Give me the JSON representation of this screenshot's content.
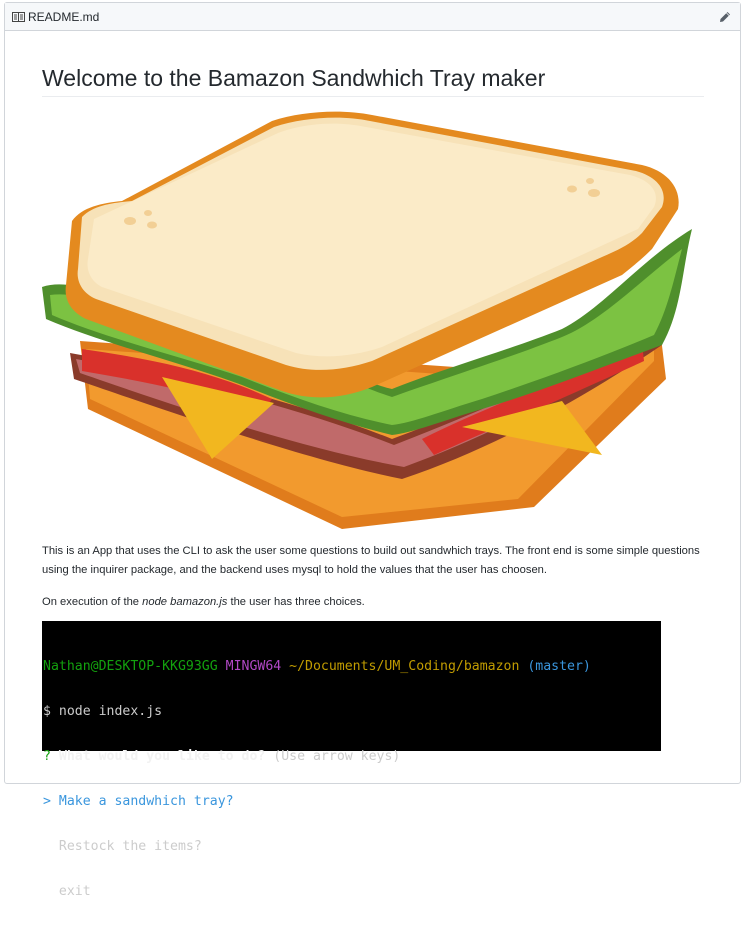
{
  "header": {
    "file_name": "README.md",
    "file_icon": "book-icon",
    "edit_icon": "pencil-icon"
  },
  "readme": {
    "title": "Welcome to the Bamazon Sandwhich Tray maker",
    "image": "sandwich-illustration",
    "paragraph1": "This is an App that uses the CLI to ask the user some questions to build out sandwhich trays. The front end is some simple questions using the inquirer package, and the backend uses mysql to hold the values that the user has choosen.",
    "paragraph2_prefix": "On execution of the ",
    "paragraph2_code": "node bamazon.js",
    "paragraph2_suffix": " the user has three choices."
  },
  "terminal": {
    "prompt_user": "Nathan@DESKTOP-KKG93GG",
    "prompt_env": "MINGW64",
    "prompt_path": "~/Documents/UM_Coding/bamazon",
    "prompt_branch": "(master)",
    "command_symbol": "$",
    "command": "node index.js",
    "question_symbol": "?",
    "question": "What would you like to do?",
    "hint": "(Use arrow keys)",
    "selected_symbol": ">",
    "options": [
      "Make a sandwhich tray?",
      "Restock the items?",
      "exit"
    ],
    "colors": {
      "user": "#13a10e",
      "env": "#b148c6",
      "path": "#c19c00",
      "branch": "#3a96dd",
      "selected": "#3a96dd",
      "text": "#cccccc",
      "bold": "#f2f2f2"
    }
  }
}
